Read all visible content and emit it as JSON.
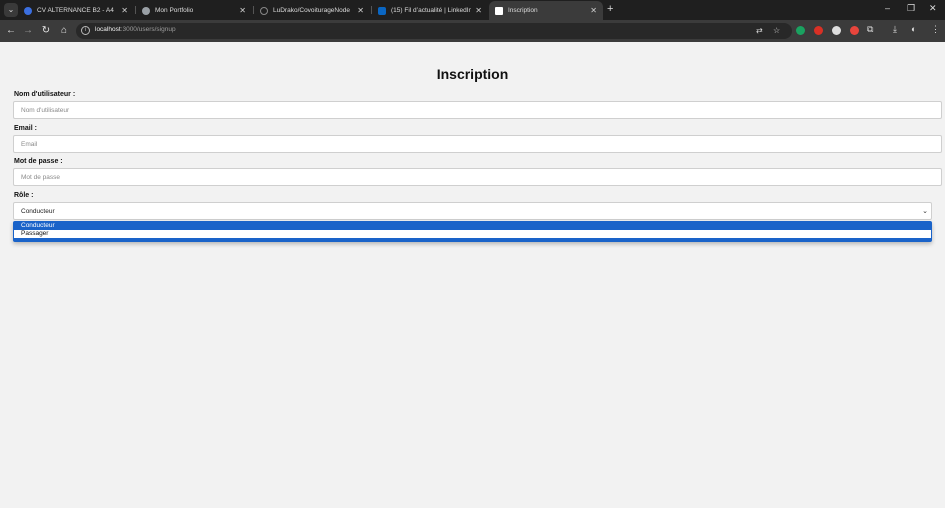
{
  "browser": {
    "tabs": [
      {
        "title": "CV ALTERNANCE B2 - A4",
        "favicon_color": "#3b6fe0"
      },
      {
        "title": "Mon Portfolio",
        "favicon_color": "#9aa0a6"
      },
      {
        "title": "LuDrako/CovoiturageNode",
        "favicon_color": "#555555"
      },
      {
        "title": "(15) Fil d’actualité | LinkedIn",
        "favicon_color": "#0a66c2"
      },
      {
        "title": "Inscription",
        "favicon_color": "#ffffff"
      }
    ],
    "tab_close": "✕",
    "new_tab": "+",
    "window_controls": {
      "minimize": "–",
      "restore": "❐",
      "close": "✕"
    },
    "nav": {
      "back": "←",
      "forward": "→",
      "reload": "↻",
      "home": "⌂"
    },
    "url_host": "localhost",
    "url_path": ":3000/users/signup",
    "extension_colors": [
      "#1aa260",
      "#d93025",
      "#dddddd",
      "#e8453c"
    ]
  },
  "form": {
    "title": "Inscription",
    "username_label": "Nom d'utilisateur :",
    "username_placeholder": "Nom d'utilisateur",
    "email_label": "Email :",
    "email_placeholder": "Email",
    "password_label": "Mot de passe :",
    "password_placeholder": "Mot de passe",
    "role_label": "Rôle :",
    "role_selected": "Conducteur",
    "role_options": [
      "Conducteur",
      "Passager"
    ]
  }
}
